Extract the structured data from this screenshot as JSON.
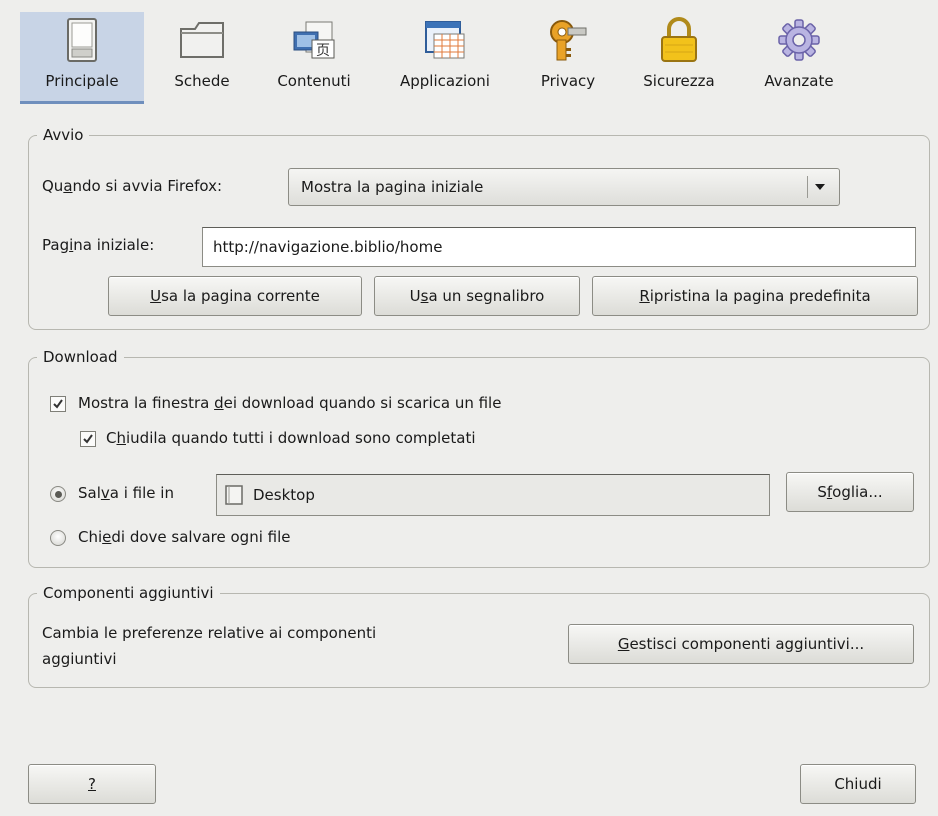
{
  "tabs": [
    {
      "label": "Principale",
      "icon": "switch-icon",
      "selected": true
    },
    {
      "label": "Schede",
      "icon": "folder-tab-icon",
      "selected": false
    },
    {
      "label": "Contenuti",
      "icon": "content-icon",
      "selected": false
    },
    {
      "label": "Applicazioni",
      "icon": "applications-icon",
      "selected": false
    },
    {
      "label": "Privacy",
      "icon": "key-icon",
      "selected": false
    },
    {
      "label": "Sicurezza",
      "icon": "lock-icon",
      "selected": false
    },
    {
      "label": "Avanzate",
      "icon": "gear-icon",
      "selected": false
    }
  ],
  "startup": {
    "legend": "Avvio",
    "when_label_pre": "Qu",
    "when_label_acc": "a",
    "when_label_post": "ndo si avvia Firefox:",
    "when_value": "Mostra la pagina iniziale",
    "home_label_pre": "Pag",
    "home_label_acc": "i",
    "home_label_post": "na iniziale:",
    "home_value": "http://navigazione.biblio/home",
    "use_current_acc": "U",
    "use_current_post": "sa la pagina corrente",
    "use_bookmark_pre": "U",
    "use_bookmark_acc": "s",
    "use_bookmark_post": "a un segnalibro",
    "restore_acc": "R",
    "restore_post": "ipristina la pagina predefinita"
  },
  "download": {
    "legend": "Download",
    "show_window_pre": "Mostra la finestra ",
    "show_window_acc": "d",
    "show_window_post": "ei download quando si scarica un file",
    "show_window_checked": true,
    "close_when_pre": "C",
    "close_when_acc": "h",
    "close_when_post": "iudila quando tutti i download sono completati",
    "close_when_checked": true,
    "save_to_pre": "Sal",
    "save_to_acc": "v",
    "save_to_post": "a i file in",
    "save_to_selected": true,
    "save_folder": "Desktop",
    "browse_pre": "S",
    "browse_acc": "f",
    "browse_post": "oglia...",
    "ask_pre": "Chi",
    "ask_acc": "e",
    "ask_post": "di dove salvare ogni file",
    "ask_selected": false
  },
  "addons": {
    "legend": "Componenti aggiuntivi",
    "description_line1": "Cambia le preferenze relative ai componenti",
    "description_line2": "aggiuntivi",
    "manage_acc": "G",
    "manage_post": "estisci componenti aggiuntivi..."
  },
  "footer": {
    "help_label": "?",
    "close_label": "Chiudi"
  },
  "colors": {
    "selected_tab_bg": "#c8d4e6",
    "window_bg": "#eeeeec"
  }
}
